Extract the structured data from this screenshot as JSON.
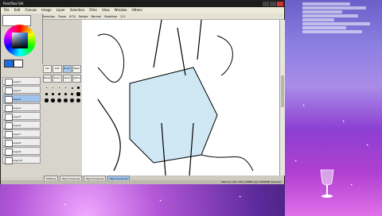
{
  "app": {
    "title": "PaintTool SAI",
    "menu": [
      "File",
      "Edit",
      "Canvas",
      "Image",
      "Layer",
      "Selection",
      "Filter",
      "View",
      "Window",
      "Others"
    ],
    "toolbar": [
      "Selection",
      "Zoom",
      "Rotate",
      "Normal",
      "Stabilizer"
    ],
    "toolbar_zoom": "67%",
    "toolbar_stabilizer": "S-5"
  },
  "colors": {
    "primary": "#1d6fe0",
    "secondary": "#ffffff",
    "accent": "#9fc4ee"
  },
  "layers": [
    {
      "name": "Layer1"
    },
    {
      "name": "Layer2"
    },
    {
      "name": "Layer3"
    },
    {
      "name": "Layer4"
    },
    {
      "name": "Layer5"
    },
    {
      "name": "Layer6"
    },
    {
      "name": "Layer7"
    },
    {
      "name": "Layer8"
    },
    {
      "name": "Layer9"
    },
    {
      "name": "Layer10"
    }
  ],
  "tools": {
    "row1": [
      "Pen",
      "AirBr",
      "Brush",
      "Water"
    ],
    "row2": [
      "Marker",
      "Eraser",
      "Select",
      "SelEra"
    ],
    "brush_sizes": [
      "1",
      "1.5",
      "2",
      "3",
      "4",
      "5",
      "6",
      "7",
      "8",
      "9",
      "10",
      "12",
      "14",
      "16",
      "20",
      "25",
      "30",
      "35"
    ]
  },
  "tabs": [
    "Fluffy.sai",
    "New Canvas.sai",
    "New Canvas.sai",
    "New Canvas.sai"
  ],
  "status": "Memory Load: 18% (138MB used / 8000MB reserved)"
}
